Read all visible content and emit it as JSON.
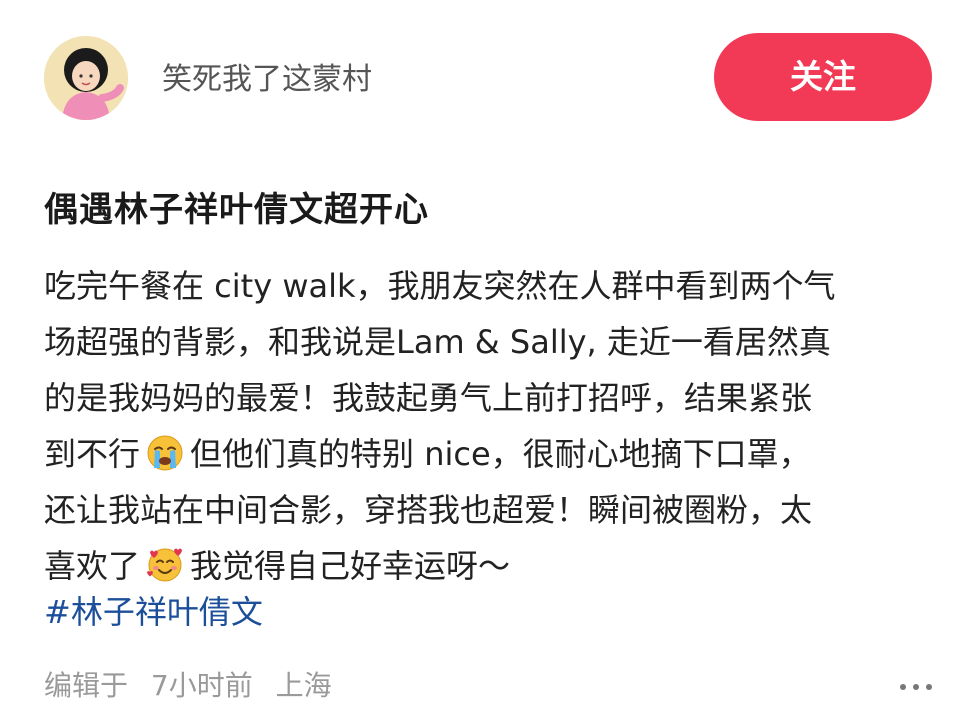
{
  "header": {
    "username": "笑死我了这蒙村",
    "follow_label": "关注",
    "accent_color": "#f23955",
    "avatar_icon": "girl-avatar-icon"
  },
  "post": {
    "title": "偶遇林子祥叶倩文超开心",
    "body_lines": [
      {
        "text": "吃完午餐在 city walk，我朋友突然在人群中看到两个气"
      },
      {
        "text": "场超强的背影，和我说是Lam & Sally, 走近一看居然真"
      },
      {
        "text": "的是我妈妈的最爱！我鼓起勇气上前打招呼，结果紧张"
      },
      {
        "before": "到不行",
        "emoji": "crying-face-icon",
        "after": "但他们真的特别 nice，很耐心地摘下口罩，"
      },
      {
        "text": "还让我站在中间合影，穿搭我也超爱！瞬间被圈粉，太"
      },
      {
        "before": "喜欢了",
        "emoji": "smiling-face-with-hearts-icon",
        "after": "我觉得自己好幸运呀～"
      }
    ],
    "hashtag": "#林子祥叶倩文",
    "hashtag_color": "#1c4f99"
  },
  "meta": {
    "edited_label": "编辑于",
    "time": "7小时前",
    "location": "上海",
    "more_icon": "more-options-icon"
  }
}
